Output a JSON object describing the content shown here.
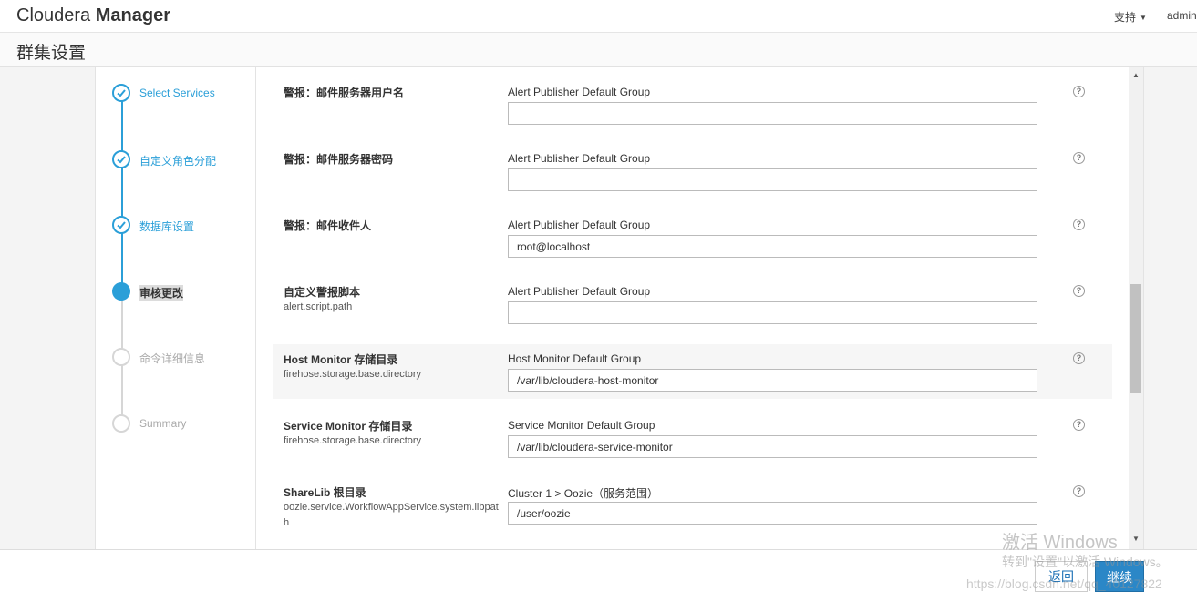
{
  "app": {
    "brand_light": "Cloudera",
    "brand_bold": "Manager",
    "support_label": "支持",
    "user_label": "admin"
  },
  "page": {
    "title": "群集设置"
  },
  "steps": [
    {
      "label": "Select Services",
      "state": "done"
    },
    {
      "label": "自定义角色分配",
      "state": "done"
    },
    {
      "label": "数据库设置",
      "state": "done"
    },
    {
      "label": "审核更改",
      "state": "active"
    },
    {
      "label": "命令详细信息",
      "state": "todo"
    },
    {
      "label": "Summary",
      "state": "todo"
    }
  ],
  "rows": [
    {
      "name": "警报：邮件服务器用户名",
      "key": "",
      "scope": "Alert Publisher Default Group",
      "value": ""
    },
    {
      "name": "警报：邮件服务器密码",
      "key": "",
      "scope": "Alert Publisher Default Group",
      "value": ""
    },
    {
      "name": "警报：邮件收件人",
      "key": "",
      "scope": "Alert Publisher Default Group",
      "value": "root@localhost"
    },
    {
      "name": "自定义警报脚本",
      "key": "alert.script.path",
      "scope": "Alert Publisher Default Group",
      "value": ""
    },
    {
      "name": "Host Monitor 存储目录",
      "key": "firehose.storage.base.directory",
      "scope": "Host Monitor Default Group",
      "value": "/var/lib/cloudera-host-monitor"
    },
    {
      "name": "Service Monitor 存储目录",
      "key": "firehose.storage.base.directory",
      "scope": "Service Monitor Default Group",
      "value": "/var/lib/cloudera-service-monitor"
    },
    {
      "name": "ShareLib 根目录",
      "key": "oozie.service.WorkflowAppService.system.libpath",
      "scope": "Cluster 1 > Oozie（服务范围）",
      "value": "/user/oozie"
    }
  ],
  "help_glyph": "?",
  "footer": {
    "back_label": "返回",
    "next_label": "继续"
  },
  "watermark": {
    "line1": "激活 Windows",
    "line2": "转到\"设置\"以激活 Windows。",
    "line3": "https://blog.csdn.net/qq_40127822"
  },
  "colors": {
    "accent": "#2b9fd8",
    "primary_button": "#2b87c7"
  }
}
